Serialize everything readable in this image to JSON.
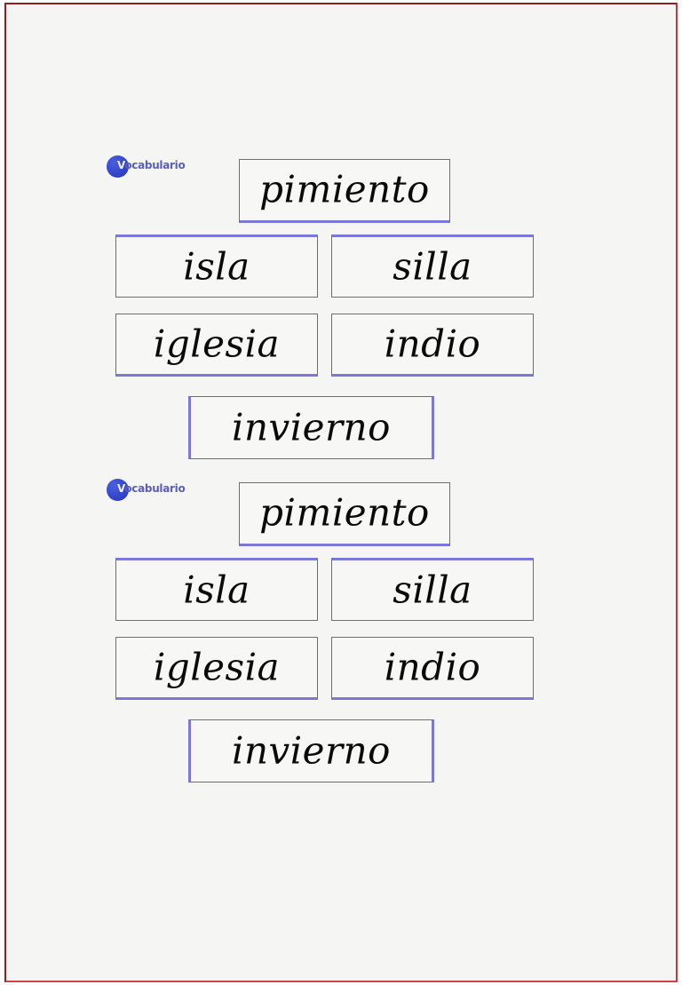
{
  "page": {
    "background_color": "#f5f5f4",
    "frame_color": "#8e1f22",
    "card_background": "#f7f7f6",
    "card_border_color": "#6e6e6e",
    "accent_color": "#7b78d8",
    "logo_circle_color": "#3243c8",
    "word_color": "#0a0a0a"
  },
  "groups": [
    {
      "logo": {
        "initial": "V",
        "rest": "ocabulario",
        "full_label": "Vocabulario"
      },
      "cards": [
        {
          "word": "pimiento",
          "accent": "bottom"
        },
        {
          "word": "isla",
          "accent": "top"
        },
        {
          "word": "silla",
          "accent": "top"
        },
        {
          "word": "iglesia",
          "accent": "bottom"
        },
        {
          "word": "indio",
          "accent": "bottom"
        },
        {
          "word": "invierno",
          "accent": "sides"
        }
      ]
    },
    {
      "logo": {
        "initial": "V",
        "rest": "ocabulario",
        "full_label": "Vocabulario"
      },
      "cards": [
        {
          "word": "pimiento",
          "accent": "bottom"
        },
        {
          "word": "isla",
          "accent": "top"
        },
        {
          "word": "silla",
          "accent": "top"
        },
        {
          "word": "iglesia",
          "accent": "bottom"
        },
        {
          "word": "indio",
          "accent": "bottom"
        },
        {
          "word": "invierno",
          "accent": "sides"
        }
      ]
    }
  ]
}
